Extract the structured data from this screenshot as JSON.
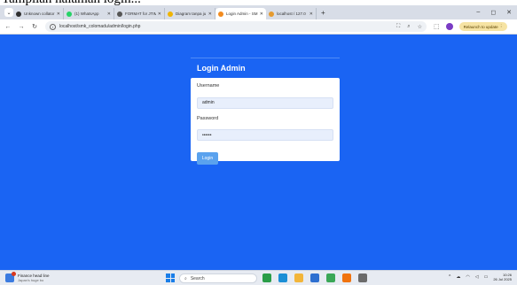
{
  "caption": "Tampilan halaman login...",
  "browser": {
    "tabs": [
      {
        "label": "Unknown collator",
        "favicon_color": "#2f2f2f",
        "active": false
      },
      {
        "label": "(1) WhatsApp",
        "favicon_color": "#25d366",
        "active": false
      },
      {
        "label": "FORMAT for JTIM",
        "favicon_color": "#555555",
        "active": false
      },
      {
        "label": "Diagram tanpa ju",
        "favicon_color": "#f0b400",
        "active": false
      },
      {
        "label": "Login Admin - SM",
        "favicon_color": "#f28b1f",
        "active": true
      },
      {
        "label": "localhost / 127.0",
        "favicon_color": "#e59a2f",
        "active": false
      }
    ],
    "new_tab_symbol": "+",
    "window_controls": [
      "–",
      "◻",
      "✕"
    ],
    "url": "localhost/smk_colomadu/admin/login.php",
    "relaunch_label": "Relaunch to update"
  },
  "page": {
    "title": "Login Admin",
    "username_label": "Username",
    "username_value": "admin",
    "password_label": "Password",
    "password_value": "••••••",
    "login_button": "Login",
    "accent_color": "#1a64f3"
  },
  "taskbar": {
    "news_title": "Finance head line",
    "news_subtitle": "Japan's huge bo",
    "search_placeholder": "Search",
    "apps": [
      {
        "name": "green-app-icon",
        "color": "#2a9d48"
      },
      {
        "name": "edge-icon",
        "color": "#1b8fd6"
      },
      {
        "name": "file-explorer-icon",
        "color": "#f2b53a"
      },
      {
        "name": "store-icon",
        "color": "#2d6fd0"
      },
      {
        "name": "chrome-icon",
        "color": "#3aa757"
      },
      {
        "name": "xampp-icon",
        "color": "#f0730f"
      },
      {
        "name": "chat-icon",
        "color": "#6b6b6b"
      }
    ],
    "time": "10:26",
    "date": "26 Jul 2025"
  }
}
